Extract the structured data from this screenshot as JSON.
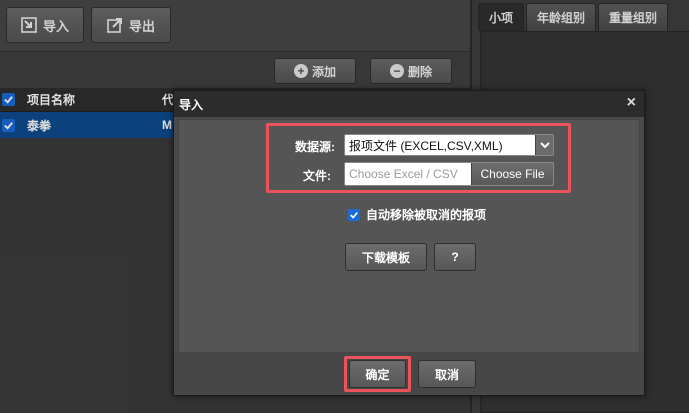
{
  "toolbar": {
    "import_label": "导入",
    "export_label": "导出"
  },
  "right_panel": {
    "tabs": [
      {
        "label": "小项"
      },
      {
        "label": "年龄组别"
      },
      {
        "label": "重量组别"
      }
    ]
  },
  "grid": {
    "add_label": "添加",
    "delete_label": "删除",
    "columns": [
      {
        "label": "项目名称"
      },
      {
        "label": "代"
      }
    ],
    "rows": [
      {
        "name": "泰拳",
        "code": "M"
      }
    ]
  },
  "dialog": {
    "title": "导入",
    "close_glyph": "×",
    "datasource_label": "数据源:",
    "datasource_value": "报项文件 (EXCEL,CSV,XML)",
    "file_label": "文件:",
    "file_placeholder": "Choose Excel / CSV",
    "file_button": "Choose File",
    "auto_remove_label": "自动移除被取消的报项",
    "auto_remove_checked": true,
    "download_template_label": "下载模板",
    "help_label": "?",
    "confirm_label": "确定",
    "cancel_label": "取消"
  },
  "colors": {
    "accent_selection": "#0e4a8f",
    "checkbox": "#1b6ad8",
    "highlight_box": "#e9535a"
  }
}
